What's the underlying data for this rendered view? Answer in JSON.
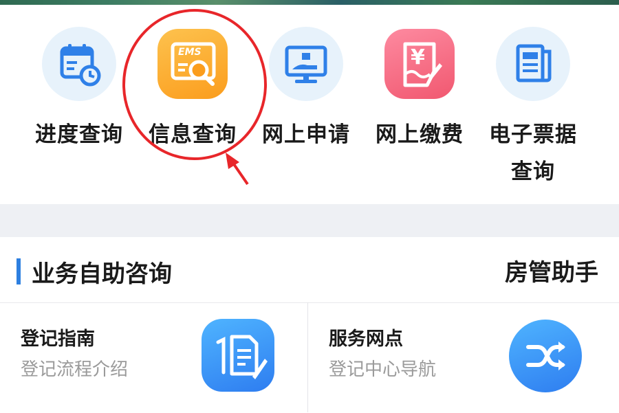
{
  "quick_actions": [
    {
      "label": "进度查询",
      "icon": "calendar-clock-icon"
    },
    {
      "label": "信息查询",
      "icon": "ems-search-icon"
    },
    {
      "label": "网上申请",
      "icon": "monitor-hand-icon"
    },
    {
      "label": "网上缴费",
      "icon": "yen-receipt-icon"
    },
    {
      "label_line1": "电子票据",
      "label_line2": "查询",
      "icon": "newspaper-icon"
    }
  ],
  "ems_badge": "EMS",
  "yen_symbol": "¥",
  "section": {
    "title": "业务自助咨询",
    "right": "房管助手"
  },
  "cards": [
    {
      "title": "登记指南",
      "subtitle": "登记流程介绍",
      "icon": "document-pen-icon"
    },
    {
      "title": "服务网点",
      "subtitle": "登记中心导航",
      "icon": "shuffle-icon"
    }
  ],
  "colors": {
    "circle_bg": "#e7f2fb",
    "icon_blue": "#2f80e8",
    "orange_tile": "#fdb233",
    "pink_tile": "#f6687e",
    "section_bar": "#2d7fe0",
    "annotation_red": "#e8262a"
  }
}
